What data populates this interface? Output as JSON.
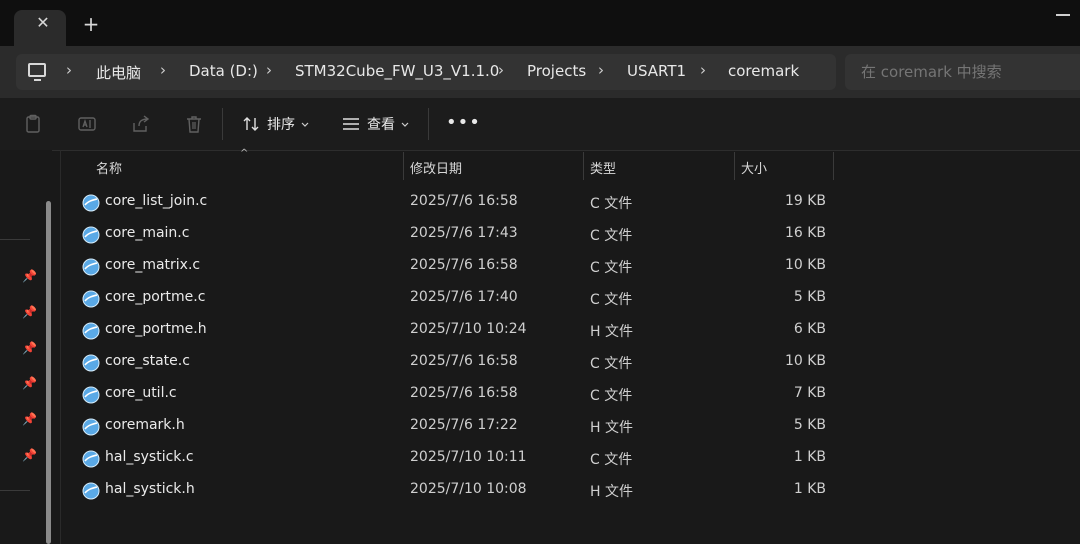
{
  "titlebar": {
    "close_glyph": "✕",
    "new_tab_glyph": "+"
  },
  "breadcrumb": {
    "icon": "computer-icon",
    "separator": "›",
    "items": [
      "此电脑",
      "Data (D:)",
      "STM32Cube_FW_U3_V1.1.0",
      "Projects",
      "USART1",
      "coremark"
    ]
  },
  "search": {
    "placeholder": "在 coremark 中搜索"
  },
  "toolbar": {
    "icons": [
      "clipboard-icon",
      "rename-icon",
      "share-icon",
      "delete-icon"
    ],
    "sort_label": "排序",
    "view_label": "查看",
    "more_label": "•••"
  },
  "columns": {
    "name": "名称",
    "date": "修改日期",
    "type": "类型",
    "size": "大小"
  },
  "files": [
    {
      "name": "core_list_join.c",
      "date": "2025/7/6 16:58",
      "type": "C 文件",
      "size": "19 KB"
    },
    {
      "name": "core_main.c",
      "date": "2025/7/6 17:43",
      "type": "C 文件",
      "size": "16 KB"
    },
    {
      "name": "core_matrix.c",
      "date": "2025/7/6 16:58",
      "type": "C 文件",
      "size": "10 KB"
    },
    {
      "name": "core_portme.c",
      "date": "2025/7/6 17:40",
      "type": "C 文件",
      "size": "5 KB"
    },
    {
      "name": "core_portme.h",
      "date": "2025/7/10 10:24",
      "type": "H 文件",
      "size": "6 KB"
    },
    {
      "name": "core_state.c",
      "date": "2025/7/6 16:58",
      "type": "C 文件",
      "size": "10 KB"
    },
    {
      "name": "core_util.c",
      "date": "2025/7/6 16:58",
      "type": "C 文件",
      "size": "7 KB"
    },
    {
      "name": "coremark.h",
      "date": "2025/7/6 17:22",
      "type": "H 文件",
      "size": "5 KB"
    },
    {
      "name": "hal_systick.c",
      "date": "2025/7/10 10:11",
      "type": "C 文件",
      "size": "1 KB"
    },
    {
      "name": "hal_systick.h",
      "date": "2025/7/10 10:08",
      "type": "H 文件",
      "size": "1 KB"
    }
  ],
  "colors": {
    "accent_icon": "#5aa9e6",
    "background": "#191919",
    "address_bg": "#2b2b2b"
  }
}
